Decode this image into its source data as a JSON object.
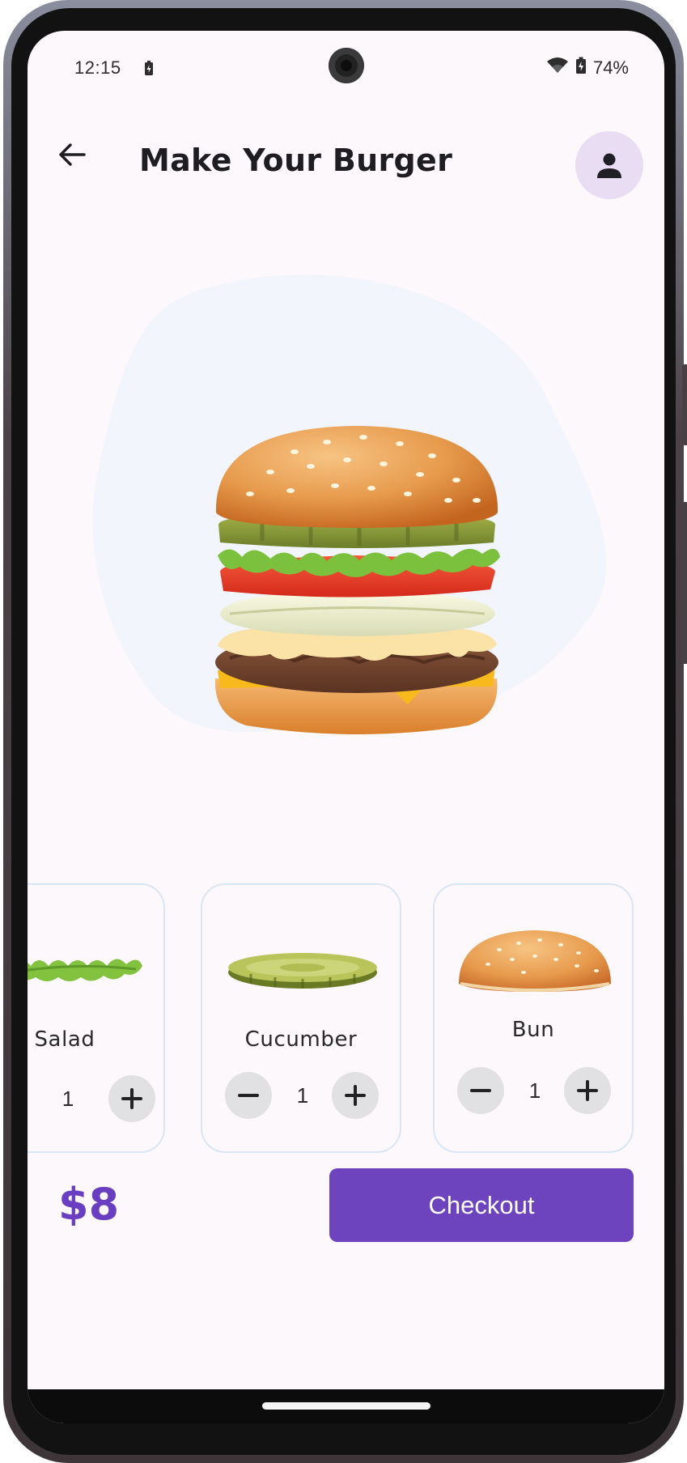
{
  "status_bar": {
    "time": "12:15",
    "battery_percent": "74%",
    "icons": [
      "battery-charging-icon",
      "wifi-icon",
      "battery-icon"
    ]
  },
  "header": {
    "title": "Make Your Burger",
    "back_icon": "arrow-back-icon",
    "profile_icon": "person-icon"
  },
  "hero": {
    "image": "burger-illustration",
    "blob_color": "#f2f5fc"
  },
  "ingredients": [
    {
      "label": "Salad",
      "quantity": "1",
      "image": "lettuce-illustration"
    },
    {
      "label": "Cucumber",
      "quantity": "1",
      "image": "pickle-slice-illustration"
    },
    {
      "label": "Bun",
      "quantity": "1",
      "image": "bun-top-illustration"
    }
  ],
  "footer": {
    "price": "$8",
    "checkout_label": "Checkout"
  },
  "colors": {
    "accent": "#6d44be",
    "price": "#6a3ec0",
    "background": "#fdf8fb",
    "avatar_bg": "#e9ddf3",
    "card_border": "#d8e6f6",
    "stepper_bg": "#e1e1e3"
  }
}
